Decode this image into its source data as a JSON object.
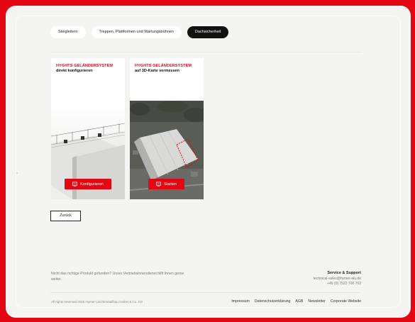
{
  "tabs": [
    {
      "label": "Steigleitern",
      "active": false
    },
    {
      "label": "Treppen, Plattformen und Wartungsbühnen",
      "active": false
    },
    {
      "label": "Dachsicherheit",
      "active": true
    }
  ],
  "cards": [
    {
      "title": "HYGHTS GELÄNDERSYSTEM",
      "subtitle": "direkt konfigurieren",
      "button": "Konfigurieren"
    },
    {
      "title": "HYGHTS GELÄNDERSYSTEM",
      "subtitle": "auf 3D-Karte vermessen",
      "button": "Starten"
    }
  ],
  "back_button": "Zurück",
  "footer": {
    "help_text": "Nicht das richtige Produkt gefunden? Unser Vertriebsinnendienst hilft Ihnen gerne weiter.",
    "service_title": "Service & Support",
    "email": "technical-sales@hymer-alu.de",
    "phone": "+49 (0) 7522 700 702",
    "copyright": "All rights reserved 2025 Hymer-Leichtmetallbau GmbH & Co. KG",
    "links": [
      "Impressum",
      "Datenschutzerklärung",
      "AGB",
      "Newsletter",
      "Corporate Website"
    ]
  },
  "colors": {
    "accent": "#e30613",
    "active_tab": "#111111",
    "page_bg": "#f4f4f2"
  }
}
